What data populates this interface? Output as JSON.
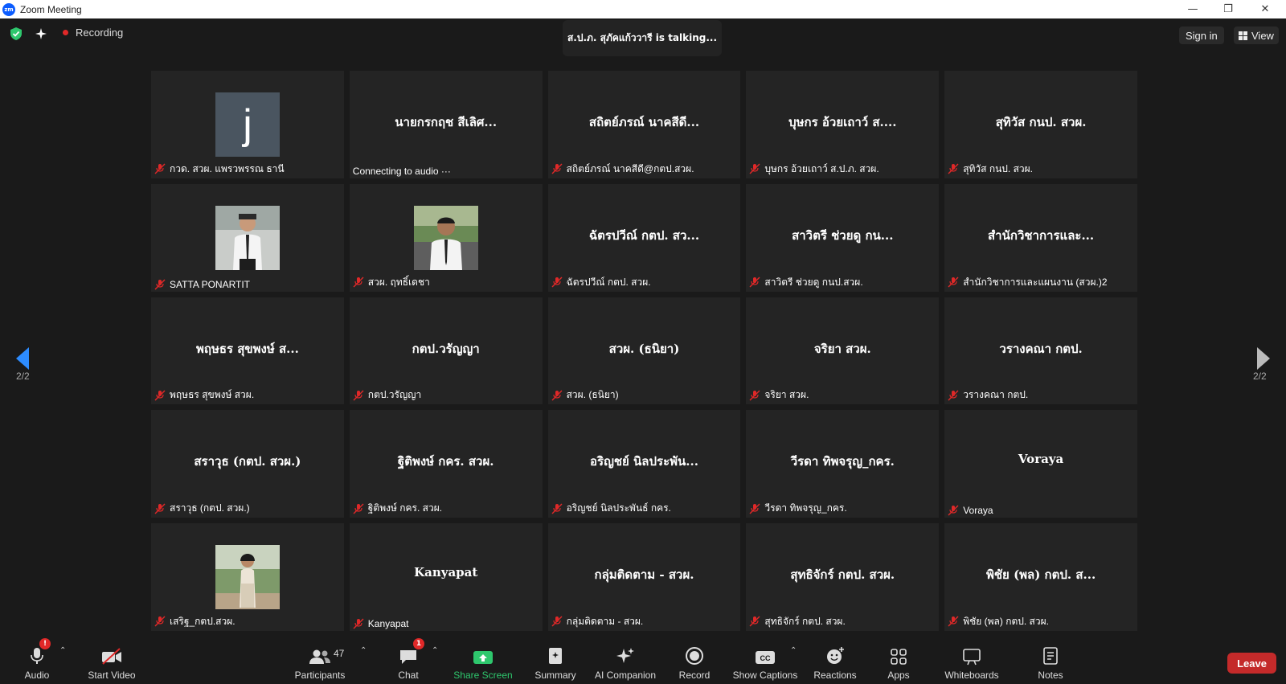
{
  "window": {
    "title": "Zoom Meeting",
    "logo_text": "zm"
  },
  "topbar": {
    "recording_label": "Recording",
    "talking_text": "ส.ป.ภ. สุภัคแก้ววารี is talking...",
    "signin_label": "Sign in",
    "view_label": "View"
  },
  "pagination": {
    "left": "2/2",
    "right": "2/2"
  },
  "tiles": [
    {
      "name": "",
      "label": "กวด. สวผ. แพรวพรรณ ธานี",
      "avatar_letter": "j",
      "muted": true
    },
    {
      "name": "นายกรกฤช สีเลิศ...",
      "label": "Connecting to audio ···",
      "muted": false
    },
    {
      "name": "สถิตย์ภรณ์ นาคสีดี...",
      "label": "สถิตย์ภรณ์ นาคสีดี@กตป.สวผ.",
      "muted": true
    },
    {
      "name": "บุษกร อ้วยเถาว์ ส....",
      "label": "บุษกร อ้วยเถาว์ ส.ป.ภ. สวผ.",
      "muted": true
    },
    {
      "name": "สุทิวัส กนป. สวผ.",
      "label": "สุทิวัส กนป. สวผ.",
      "muted": true
    },
    {
      "name": "",
      "label": "SATTA PONARTIT",
      "photo": "man-white-shirt",
      "muted": true
    },
    {
      "name": "",
      "label": "สวผ. ฤทธิ์เดชา",
      "photo": "man-outdoor",
      "muted": true
    },
    {
      "name": "ฉัตรปวีณ์ กตป. สว...",
      "label": "ฉัตรปวีณ์ กตป. สวผ.",
      "muted": true
    },
    {
      "name": "สาวิตรี ช่วยดู  กน...",
      "label": "สาวิตรี ช่วยดู  กนป.สวผ.",
      "muted": true
    },
    {
      "name": "สำนักวิชาการและ...",
      "label": "สำนักวิชาการและแผนงาน (สวผ.)2",
      "muted": true
    },
    {
      "name": "พฤษธร สุขพงษ์ ส...",
      "label": "พฤษธร สุขพงษ์ สวผ.",
      "muted": true
    },
    {
      "name": "กตป.วรัญญา",
      "label": "กตป.วรัญญา",
      "muted": true
    },
    {
      "name": "สวผ. (ธนิยา)",
      "label": "สวผ. (ธนิยา)",
      "muted": true
    },
    {
      "name": "จริยา สวผ.",
      "label": "จริยา สวผ.",
      "muted": true
    },
    {
      "name": "วรางคณา กตป.",
      "label": "วรางคณา กตป.",
      "muted": true
    },
    {
      "name": "สราวุธ (กตป. สวผ.)",
      "label": "สราวุธ (กตป. สวผ.)",
      "muted": true
    },
    {
      "name": "ฐิติพงษ์ กคร. สวผ.",
      "label": "ฐิติพงษ์ กคร. สวผ.",
      "muted": true
    },
    {
      "name": "อริญชย์ นิลประพัน...",
      "label": "อริญชย์ นิลประพันธ์ กคร.",
      "muted": true
    },
    {
      "name": "วีรดา ทิพจรุญ_กคร.",
      "label": "วีรดา ทิพจรุญ_กคร.",
      "muted": true
    },
    {
      "name": "Voraya",
      "label": "Voraya",
      "muted": true
    },
    {
      "name": "",
      "label": "เสริฐ_กตป.สวผ.",
      "photo": "woman-outdoor",
      "muted": true
    },
    {
      "name": "Kanyapat",
      "label": "Kanyapat",
      "muted": true
    },
    {
      "name": "กลุ่มติดตาม - สวผ.",
      "label": "กลุ่มติดตาม - สวผ.",
      "muted": true
    },
    {
      "name": "สุทธิจักร์ กตป. สวผ.",
      "label": "สุทธิจักร์ กตป. สวผ.",
      "muted": true
    },
    {
      "name": "พิชัย (พล) กตป. ส...",
      "label": "พิชัย (พล) กตป. สวผ.",
      "muted": true
    }
  ],
  "toolbar": {
    "audio": "Audio",
    "start_video": "Start Video",
    "participants": "Participants",
    "participants_count": "47",
    "chat": "Chat",
    "chat_badge": "1",
    "audio_badge": "!",
    "share_screen": "Share Screen",
    "summary": "Summary",
    "ai_companion": "AI Companion",
    "record": "Record",
    "show_captions": "Show Captions",
    "reactions": "Reactions",
    "apps": "Apps",
    "whiteboards": "Whiteboards",
    "notes": "Notes",
    "leave": "Leave"
  },
  "colors": {
    "accent_green": "#2ec76d",
    "leave_red": "#c42a2a",
    "mute_red": "#e02828",
    "tile_bg": "#242424"
  }
}
